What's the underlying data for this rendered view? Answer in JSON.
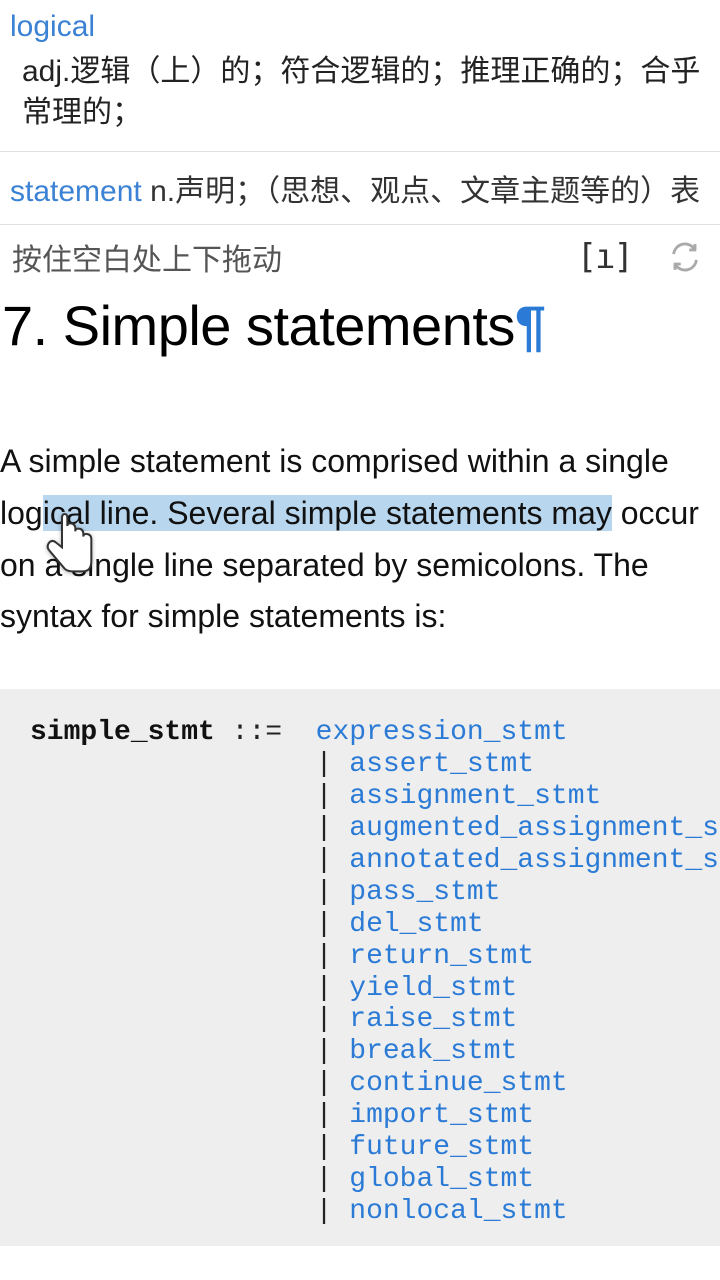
{
  "dict": {
    "word1": "logical",
    "def1": "adj.逻辑（上）的；符合逻辑的；推理正确的；合乎常理的；",
    "word2": "statement",
    "def2": " n.声明；（思想、观点、文章主题等的）表"
  },
  "toolbar": {
    "hint": "按住空白处上下拖动",
    "icon1": "[ı]"
  },
  "doc": {
    "heading_num": "7. ",
    "heading_text": "Simple statements",
    "pilcrow": "¶",
    "para_pre": "A simple statement is comprised within a single log",
    "para_highlight_rest": " line. Several simple statements may",
    "para_after": " occur on a single line separated by semicolons. The syntax for simple statements is:"
  },
  "grammar": {
    "lhs": "simple_stmt",
    "op": " ::=  ",
    "items": [
      "expression_stmt",
      "assert_stmt",
      "assignment_stmt",
      "augmented_assignment_stmt",
      "annotated_assignment_stmt",
      "pass_stmt",
      "del_stmt",
      "return_stmt",
      "yield_stmt",
      "raise_stmt",
      "break_stmt",
      "continue_stmt",
      "import_stmt",
      "future_stmt",
      "global_stmt",
      "nonlocal_stmt"
    ]
  }
}
